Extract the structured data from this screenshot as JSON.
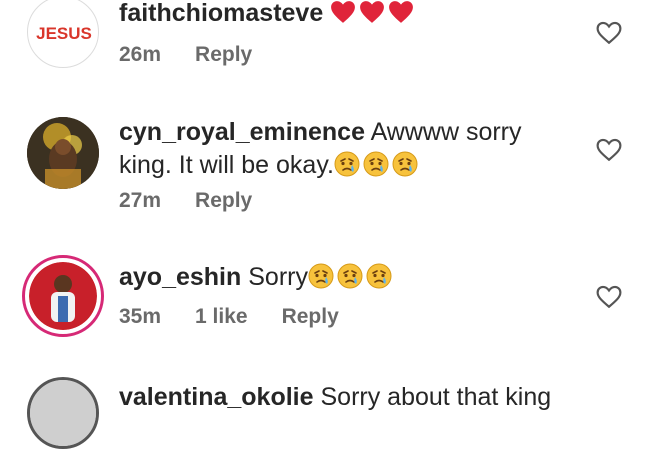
{
  "comments": [
    {
      "username": "faithchiomasteve",
      "text": "",
      "emojis": [
        "red-heart",
        "red-heart",
        "red-heart"
      ],
      "time": "26m",
      "likes": "",
      "reply_label": "Reply",
      "avatar_text": "JESUS"
    },
    {
      "username": "cyn_royal_eminence",
      "text": "Awwww sorry king. It will be okay.",
      "emojis": [
        "crying-face",
        "crying-face",
        "crying-face"
      ],
      "time": "27m",
      "likes": "",
      "reply_label": "Reply"
    },
    {
      "username": "ayo_eshin",
      "text": "Sorry",
      "emojis": [
        "crying-face",
        "crying-face",
        "crying-face"
      ],
      "time": "35m",
      "likes": "1 like",
      "reply_label": "Reply"
    },
    {
      "username": "valentina_okolie",
      "text": "Sorry about that king",
      "emojis": [],
      "time": "",
      "likes": "",
      "reply_label": ""
    }
  ],
  "colors": {
    "heart_red": "#e0243a",
    "meta_gray": "#6a6a6a",
    "text": "#262626",
    "story_ring": "#d62976"
  }
}
